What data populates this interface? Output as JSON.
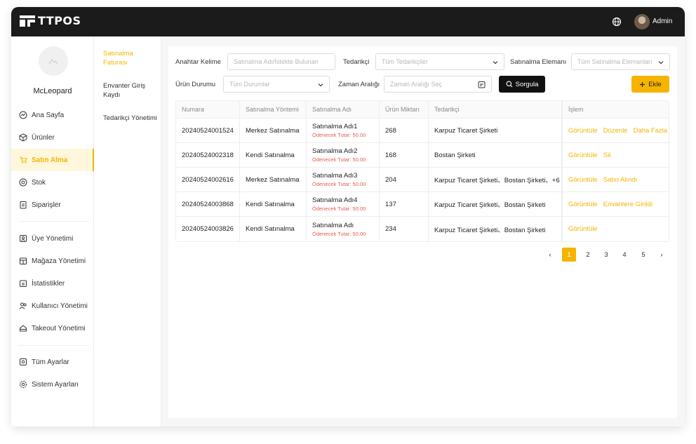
{
  "app": {
    "brand": "TTPOS",
    "user": "Admin"
  },
  "sidebar": {
    "store_name": "McLeopard",
    "items": [
      {
        "label": "Ana Sayfa",
        "icon": "dashboard-icon"
      },
      {
        "label": "Ürünler",
        "icon": "box-icon"
      },
      {
        "label": "Satın Alma",
        "icon": "cart-icon",
        "active": true
      },
      {
        "label": "Stok",
        "icon": "stock-icon"
      },
      {
        "label": "Siparişler",
        "icon": "orders-icon"
      },
      {
        "label": "Üye Yönetimi",
        "icon": "member-icon"
      },
      {
        "label": "Mağaza Yönetimi",
        "icon": "store-icon"
      },
      {
        "label": "İstatistikler",
        "icon": "stats-icon"
      },
      {
        "label": "Kullanıcı Yönetimi",
        "icon": "users-icon"
      },
      {
        "label": "Takeout Yönetimi",
        "icon": "takeout-icon"
      },
      {
        "label": "Tüm Ayarlar",
        "icon": "all-settings-icon"
      },
      {
        "label": "Sistem Ayarları",
        "icon": "gear-icon"
      }
    ]
  },
  "subnav": {
    "items": [
      {
        "label": "Satınalma Faturası",
        "active": true
      },
      {
        "label": "Envanter Giriş Kaydı"
      },
      {
        "label": "Tedarikçi Yönetimi"
      }
    ]
  },
  "filters": {
    "keyword_label": "Anahtar Kelime",
    "keyword_placeholder": "Satınalma Adı/İstekte Bulunan",
    "supplier_label": "Tedarikçi",
    "supplier_value": "Tüm Tedarikçiler",
    "staff_label": "Satınalma Elemanı",
    "staff_value": "Tüm Satınalma Elemanları",
    "status_label": "Ürün Durumu",
    "status_value": "Tüm Durumlar",
    "date_label": "Zaman Aralığı",
    "date_placeholder": "Zaman Aralığı Seç",
    "query_label": "Sorgula",
    "add_label": "Ekle"
  },
  "table": {
    "headers": [
      "Numara",
      "Satınalma Yöntemi",
      "Satınalma Adı",
      "Ürün Miktarı",
      "Tedarikçi",
      "İşlem"
    ],
    "rows": [
      {
        "number": "20240524001524",
        "method": "Merkez Satınalma",
        "name": "Satınalma Adı1",
        "amount_label": "Ödenecek Tutar:  50.00",
        "qty": "268",
        "supplier": "Karpuz Ticaret Şirketi",
        "actions": [
          "Görüntüle",
          "Düzenle",
          "Daha Fazla"
        ]
      },
      {
        "number": "20240524002318",
        "method": "Kendi Satınalma",
        "name": "Satınalma Adı2",
        "amount_label": "Ödenecek Tutar:  50.00",
        "qty": "168",
        "supplier": "Bostan Şirketi",
        "actions": [
          "Görüntüle",
          "Sil"
        ]
      },
      {
        "number": "20240524002616",
        "method": "Merkez Satınalma",
        "name": "Satınalma Adı3",
        "amount_label": "Ödenecek Tutar:  50.00",
        "qty": "204",
        "supplier": "Karpuz Ticaret Şirketi、Bostan Şirketi、+6",
        "actions": [
          "Görüntüle",
          "Satın Alındı"
        ]
      },
      {
        "number": "20240524003868",
        "method": "Kendi Satınalma",
        "name": "Satınalma Adı4",
        "amount_label": "Ödenecek Tutar:  50.00",
        "qty": "137",
        "supplier": "Karpuz Ticaret Şirketi、Bostan Şirketi",
        "actions": [
          "Görüntüle",
          "Envantere Girildi"
        ]
      },
      {
        "number": "20240524003826",
        "method": "Kendi Satınalma",
        "name": "Satınalma Adı",
        "amount_label": "Ödenecek Tutar:  50.00",
        "qty": "234",
        "supplier": "Karpuz Ticaret Şirketi、Bostan Şirketi",
        "actions": [
          "Görüntüle"
        ]
      }
    ]
  },
  "pagination": {
    "prev": "‹",
    "next": "›",
    "pages": [
      "1",
      "2",
      "3",
      "4",
      "5"
    ],
    "current": "1"
  },
  "colors": {
    "accent": "#f5b400",
    "topbar": "#1b1b1b",
    "amount": "#e85a4f"
  }
}
